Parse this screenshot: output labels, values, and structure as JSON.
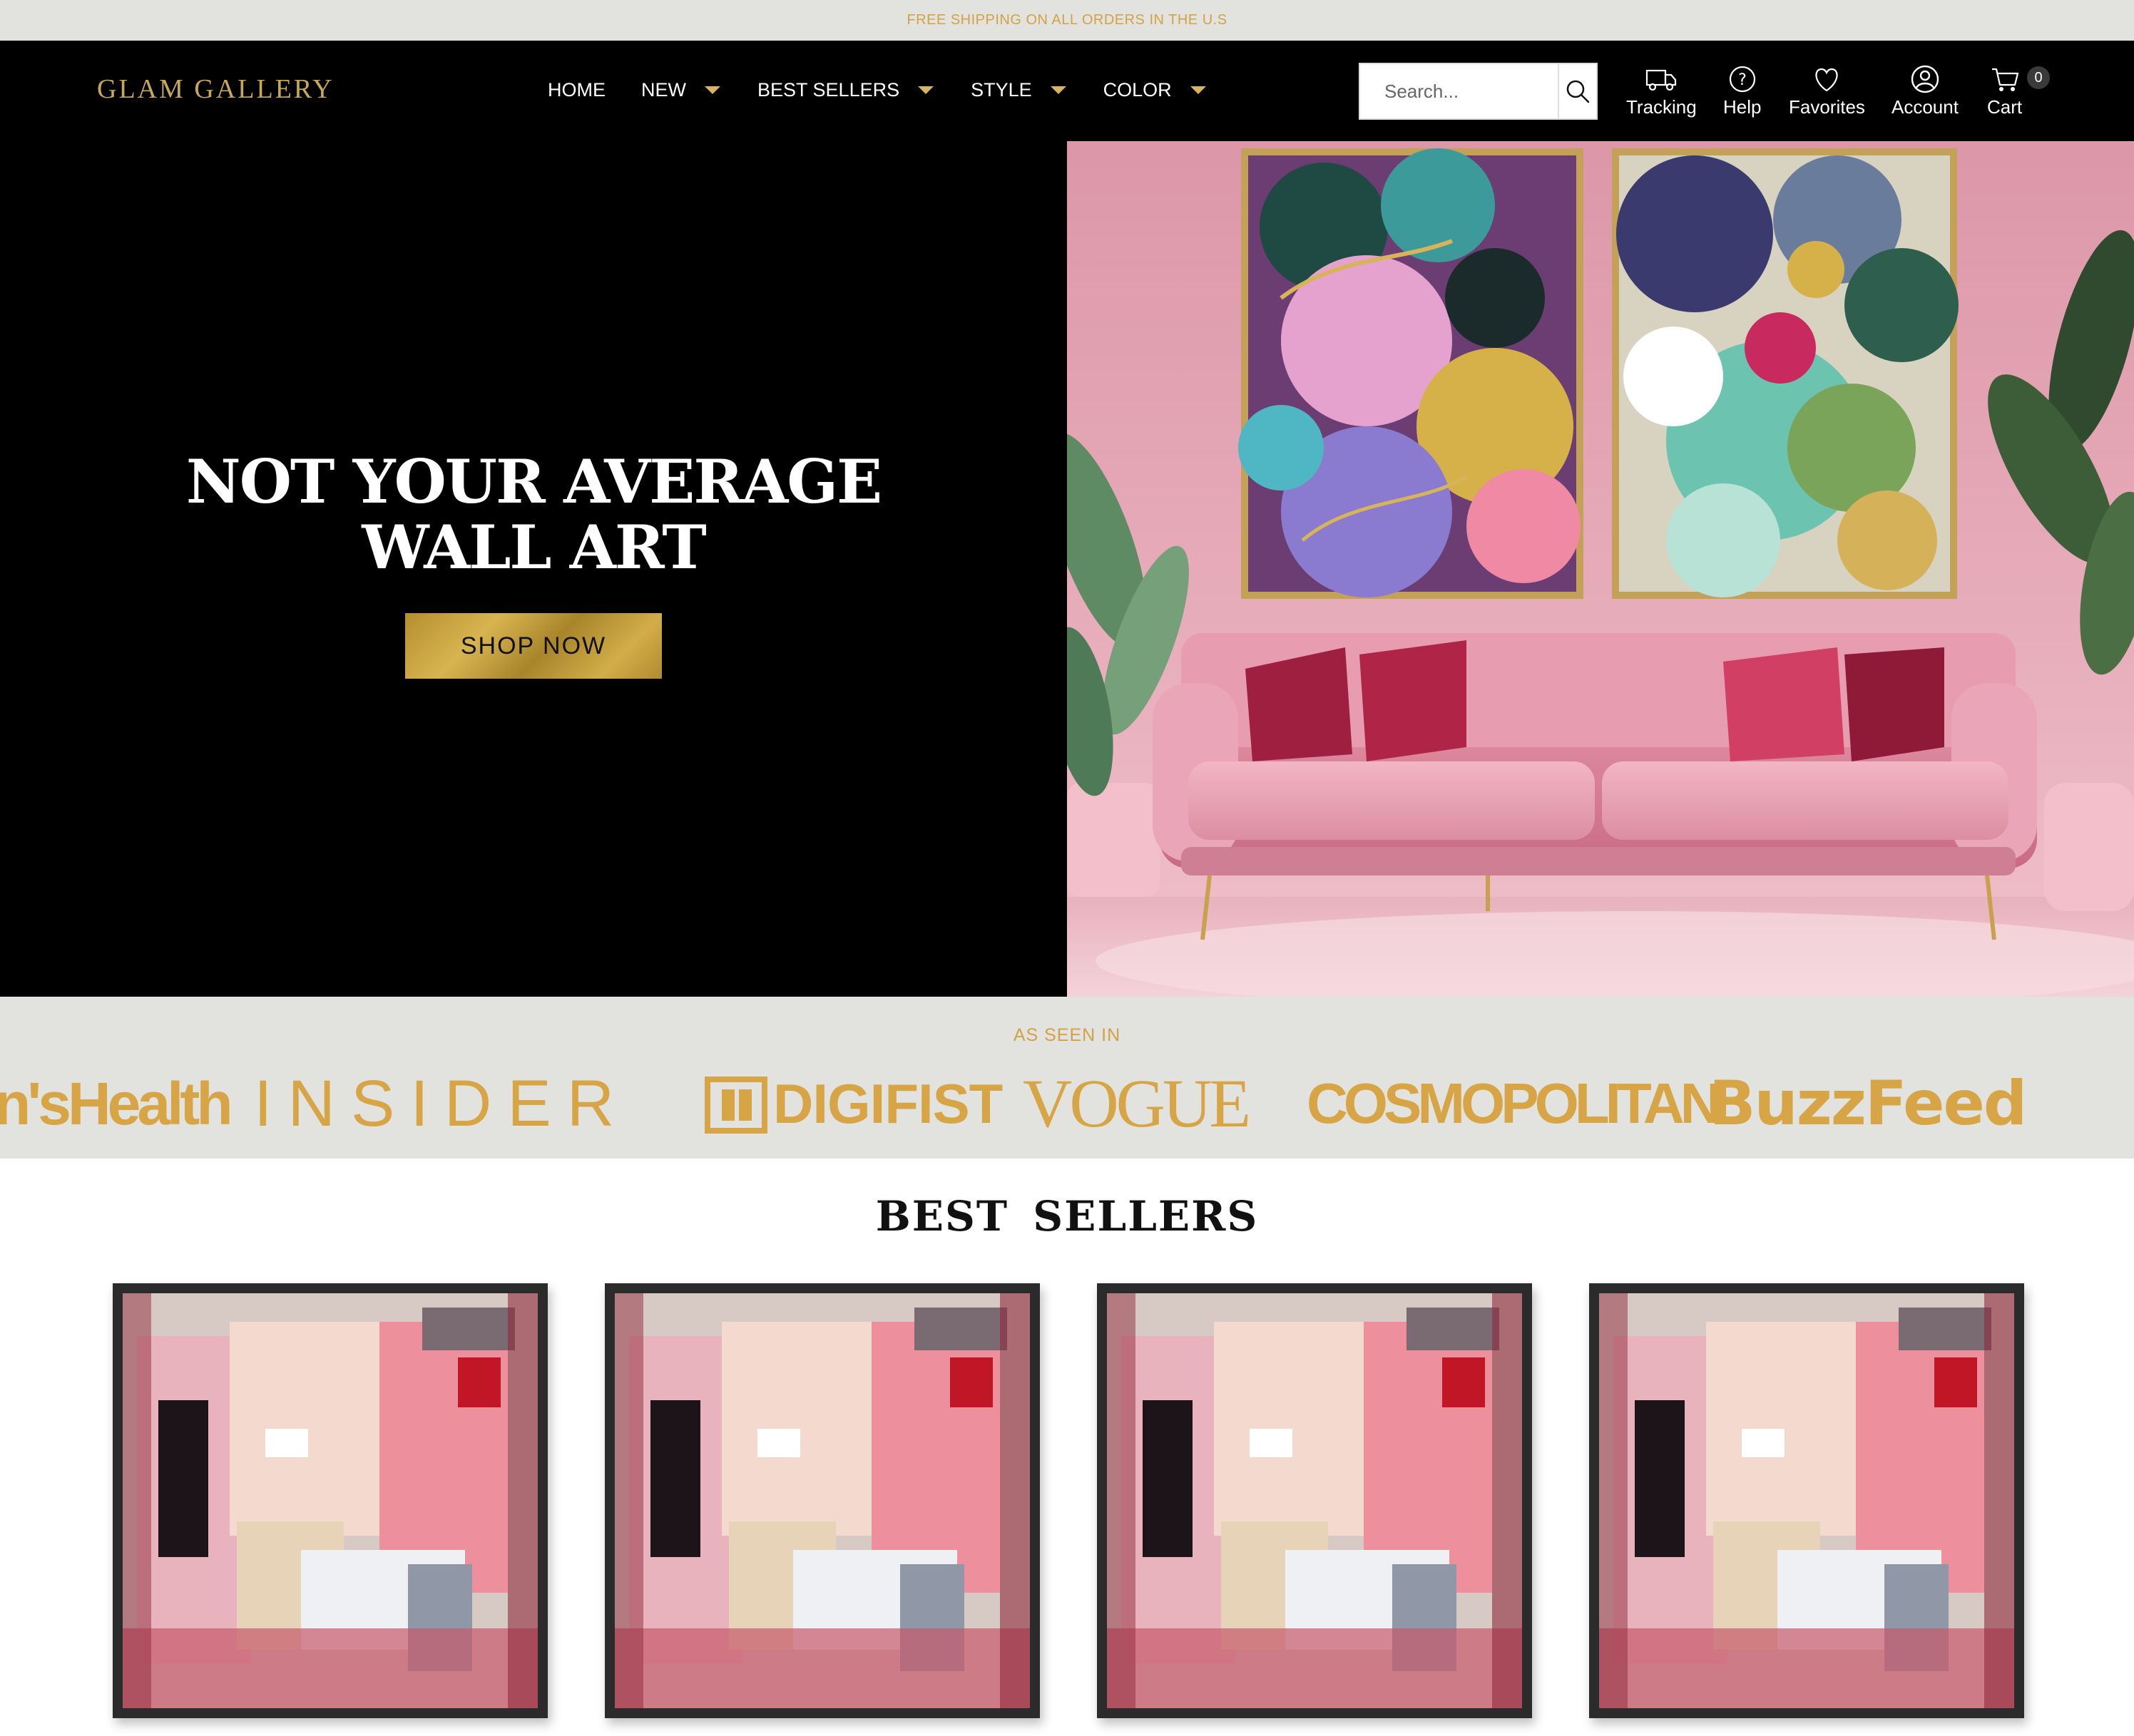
{
  "announcement": "FREE SHIPPING ON ALL ORDERS IN THE U.S",
  "header": {
    "logo": "GLAM GALLERY",
    "nav": [
      {
        "label": "HOME",
        "has_dropdown": false
      },
      {
        "label": "NEW",
        "has_dropdown": true
      },
      {
        "label": "BEST SELLERS",
        "has_dropdown": true
      },
      {
        "label": "STYLE",
        "has_dropdown": true
      },
      {
        "label": "COLOR",
        "has_dropdown": true
      }
    ],
    "search": {
      "placeholder": "Search..."
    },
    "icons": {
      "tracking": "Tracking",
      "help": "Help",
      "favorites": "Favorites",
      "account": "Account",
      "cart": "Cart",
      "cart_count": "0"
    }
  },
  "hero": {
    "title_line1": "NOT YOUR AVERAGE",
    "title_line2": "WALL ART",
    "cta": "SHOP NOW"
  },
  "as_seen_in": {
    "title": "AS SEEN IN",
    "brands": [
      "n'sHealth",
      "INSIDER",
      "DIGIFIST",
      "VOGUE",
      "COSMOPOLITAN",
      "BuzzFeed"
    ]
  },
  "best_sellers": {
    "title": "BEST  SELLERS"
  },
  "colors": {
    "gold": "#d1a246",
    "black": "#000000",
    "light_gray": "#e2e3df",
    "pink_wall": "#e6a9ba"
  }
}
